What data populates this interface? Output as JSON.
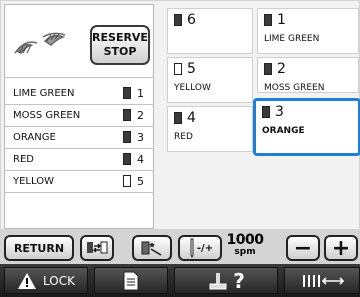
{
  "reserve_stop": {
    "line1": "RESERVE",
    "line2": "STOP"
  },
  "sequence": [
    {
      "name": "LIME GREEN",
      "num": "1",
      "spool": "filled"
    },
    {
      "name": "MOSS GREEN",
      "num": "2",
      "spool": "filled"
    },
    {
      "name": "ORANGE",
      "num": "3",
      "spool": "filled"
    },
    {
      "name": "RED",
      "num": "4",
      "spool": "filled"
    },
    {
      "name": "YELLOW",
      "num": "5",
      "spool": "empty"
    }
  ],
  "needles": {
    "n6": {
      "num": "6",
      "name": "",
      "spool": "filled"
    },
    "n1": {
      "num": "1",
      "name": "LIME GREEN",
      "spool": "filled"
    },
    "n5": {
      "num": "5",
      "name": "YELLOW",
      "spool": "empty"
    },
    "n2": {
      "num": "2",
      "name": "MOSS GREEN",
      "spool": "filled"
    },
    "n4": {
      "num": "4",
      "name": "RED",
      "spool": "filled"
    },
    "n3": {
      "num": "3",
      "name": "ORANGE",
      "spool": "filled",
      "selected": true
    }
  },
  "buttons": {
    "return": "RETURN",
    "speed_toggle": "-/+",
    "speed_value": "1000",
    "speed_unit": "spm",
    "minus": "−",
    "plus": "+",
    "lock": "LOCK",
    "help": "?"
  },
  "colors": {
    "selection": "#1e7fd6"
  }
}
